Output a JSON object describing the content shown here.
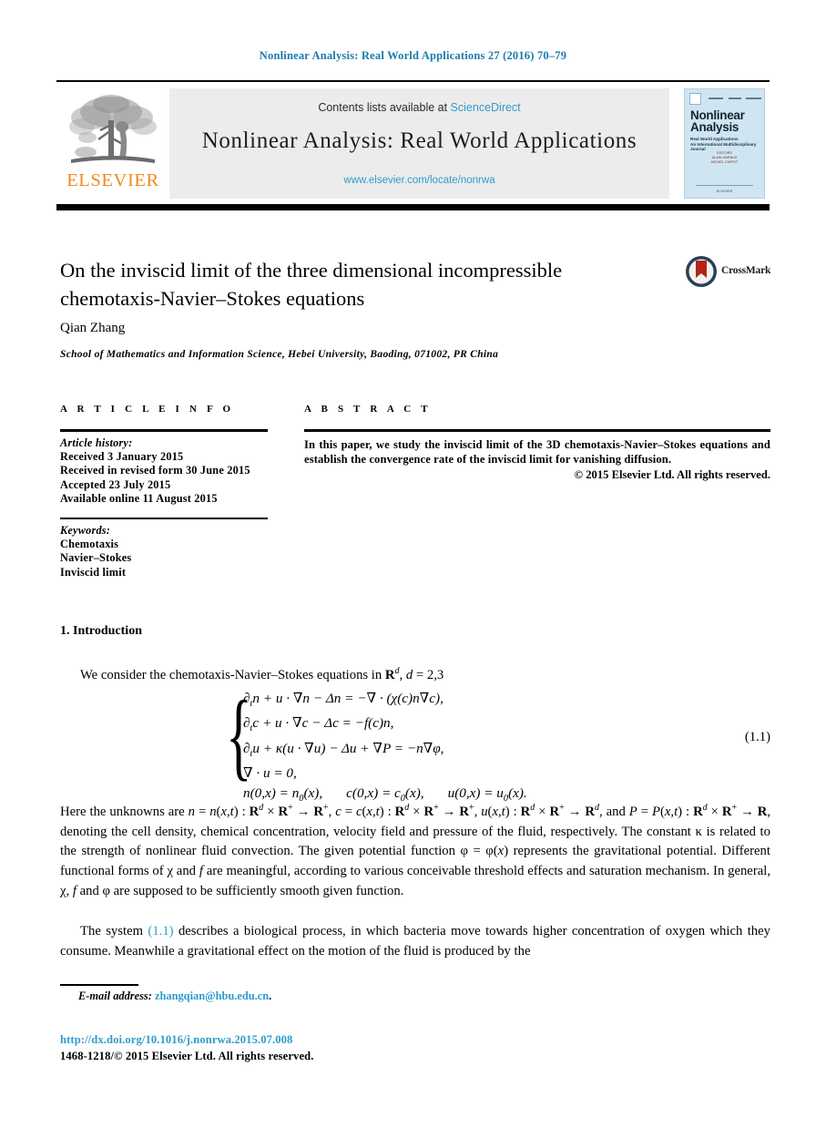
{
  "running_head": "Nonlinear Analysis: Real World Applications 27 (2016) 70–79",
  "masthead": {
    "contents_prefix": "Contents lists available at ",
    "sciencedirect": "ScienceDirect",
    "journal_title": "Nonlinear Analysis: Real World Applications",
    "journal_url": "www.elsevier.com/locate/nonrwa",
    "publisher_wordmark": "ELSEVIER",
    "cover": {
      "title_line1": "Nonlinear",
      "title_line2": "Analysis",
      "subtitle": "Real World Applications",
      "subtitle2": "An International Multidisciplinary Journal",
      "editors_label": "EDITORS",
      "editor1": "ALAIN HARAUX",
      "editor2": "MICHEL CHIPOT",
      "footer": "ELSEVIER"
    }
  },
  "article": {
    "title_line1": "On the inviscid limit of the three dimensional incompressible",
    "title_line2": "chemotaxis-Navier–Stokes equations",
    "crossmark_label": "CrossMark",
    "author": "Qian Zhang",
    "affiliation": "School of Mathematics and Information Science, Hebei University, Baoding, 071002, PR China"
  },
  "info": {
    "heading": "A R T I C L E   I N F O",
    "history_label": "Article history:",
    "history": [
      "Received 3 January 2015",
      "Received in revised form 30 June 2015",
      "Accepted 23 July 2015",
      "Available online 11 August 2015"
    ],
    "keywords_label": "Keywords:",
    "keywords": [
      "Chemotaxis",
      "Navier–Stokes",
      "Inviscid limit"
    ]
  },
  "abstract": {
    "heading": "A B S T R A C T",
    "text": "In this paper, we study the inviscid limit of the 3D chemotaxis-Navier–Stokes equations and establish the convergence rate of the inviscid limit for vanishing diffusion.",
    "copyright": "© 2015 Elsevier Ltd. All rights reserved."
  },
  "body": {
    "section_heading": "1. Introduction",
    "intro_text": "We consider the chemotaxis-Navier–Stokes equations in",
    "intro_math": "R^d, d = 2,3",
    "equation_tag": "(1.1)",
    "equation_lines": [
      "∂tn + u · ∇n − Δn = −∇ · (χ(c)n∇c),",
      "∂tc + u · ∇c − Δc = −f(c)n,",
      "∂tu + κ(u · ∇u) − Δu + ∇P = −n∇φ,",
      "∇ · u = 0,",
      "n(0,x) = n0(x),     c(0,x) = c0(x),     u(0,x) = u0(x)."
    ],
    "para_after_eq": "Here the unknowns are n = n(x,t) : R^d × R^+ → R^+, c = c(x,t) : R^d × R^+ → R^+, u(x,t) : R^d × R^+ → R^d, and P = P(x,t) : R^d × R^+ → R, denoting the cell density, chemical concentration, velocity field and pressure of the fluid, respectively. The constant κ is related to the strength of nonlinear fluid convection. The given potential function φ = φ(x) represents the gravitational potential. Different functional forms of χ and f are meaningful, according to various conceivable threshold effects and saturation mechanism. In general, χ, f and φ are supposed to be sufficiently smooth given function.",
    "para_last_a": "The system ",
    "para_last_ref": "(1.1)",
    "para_last_b": " describes a biological process, in which bacteria move towards higher concentration of oxygen which they consume. Meanwhile a gravitational effect on the motion of the fluid is produced by the"
  },
  "footer": {
    "email_label": "E-mail address:",
    "email": "zhangqian@hbu.edu.cn",
    "email_suffix": ".",
    "doi": "http://dx.doi.org/10.1016/j.nonrwa.2015.07.008",
    "issn": "1468-1218/© 2015 Elsevier Ltd. All rights reserved."
  },
  "colors": {
    "link_blue": "#2f9ccc",
    "running_head_blue": "#1a7bab",
    "elsevier_orange": "#f08a1c",
    "masthead_grey": "#ececec",
    "cover_blue": "#cfe6f2",
    "crossmark_red": "#b32317",
    "crossmark_ring": "#2b3f56"
  }
}
